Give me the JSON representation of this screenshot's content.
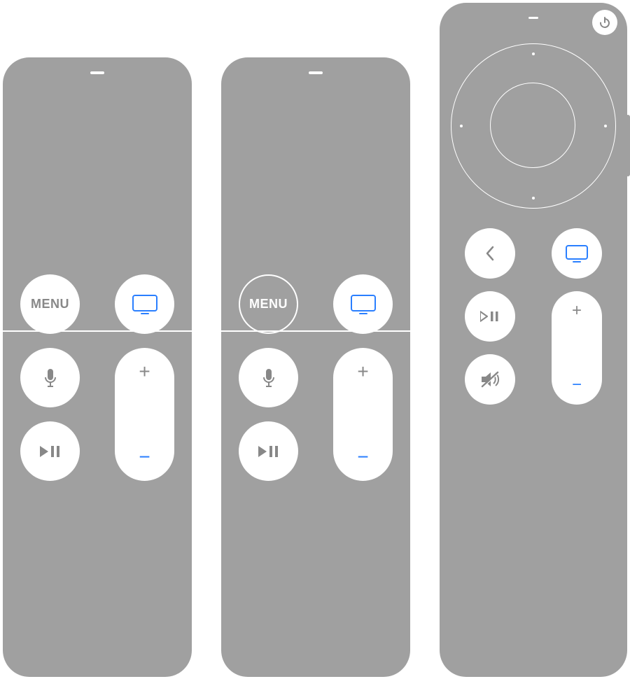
{
  "colors": {
    "body": "#a0a0a0",
    "button": "#ffffff",
    "accent": "#2a7fff",
    "icon_gray": "#888888"
  },
  "remotes": {
    "gen1": {
      "menu_label": "MENU",
      "icons": {
        "tv": "tv-icon",
        "mic": "microphone-icon",
        "playpause": "play-pause-icon"
      },
      "volume": {
        "up": "+",
        "down": "−"
      }
    },
    "gen2": {
      "menu_label": "MENU",
      "menu_highlighted": true,
      "icons": {
        "tv": "tv-icon",
        "mic": "microphone-icon",
        "playpause": "play-pause-icon"
      },
      "volume": {
        "up": "+",
        "down": "−"
      }
    },
    "gen3": {
      "icons": {
        "power": "power-icon",
        "back": "chevron-left-icon",
        "tv": "tv-icon",
        "playpause": "play-pause-icon",
        "mute": "mute-icon"
      },
      "volume": {
        "up": "+",
        "down": "−"
      }
    }
  }
}
